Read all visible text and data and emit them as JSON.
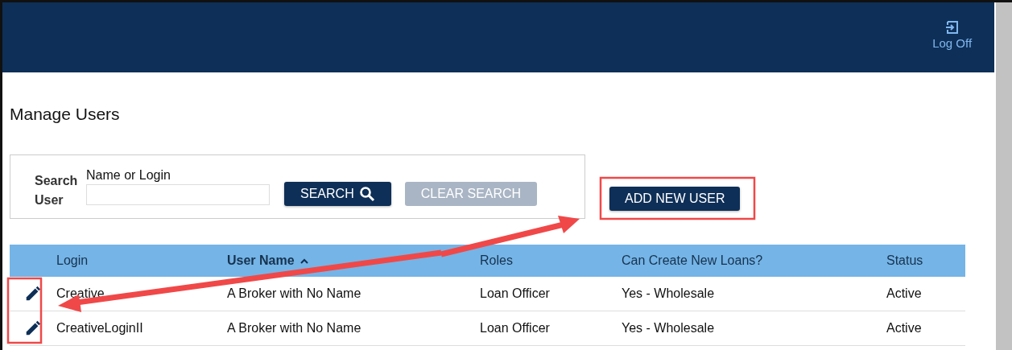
{
  "header": {
    "log_off": "Log Off"
  },
  "page_title": "Manage Users",
  "search": {
    "label": "Search User",
    "field_label": "Name or Login",
    "buttons": [
      {
        "label": "SEARCH",
        "kind": "search",
        "disabled": false
      },
      {
        "label": "CLEAR SEARCH",
        "kind": "clear",
        "disabled": true
      }
    ]
  },
  "add_button": "ADD NEW USER",
  "table": {
    "columns": [
      {
        "label": "Login",
        "sorted": false
      },
      {
        "label": "User Name",
        "sorted": true
      },
      {
        "label": "Roles",
        "sorted": false
      },
      {
        "label": "Can Create New Loans?",
        "sorted": false
      },
      {
        "label": "Status",
        "sorted": false
      }
    ],
    "rows": [
      [
        "Creative",
        "A Broker with No Name",
        "Loan Officer",
        "Yes - Wholesale",
        "Active"
      ],
      [
        "CreativeLoginII",
        "A Broker with No Name",
        "Loan Officer",
        "Yes - Wholesale",
        "Active"
      ]
    ]
  }
}
